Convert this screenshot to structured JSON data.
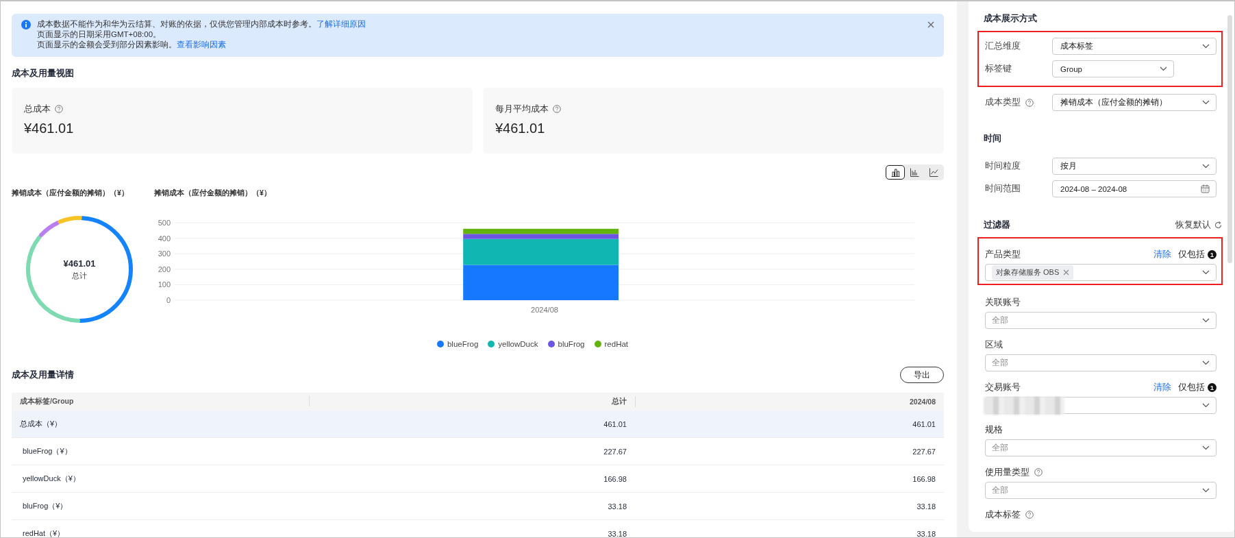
{
  "notice": {
    "lines": [
      {
        "text": "成本数据不能作为和华为云结算、对账的依据，仅供您管理内部成本时参考。",
        "link": "了解详细原因"
      },
      {
        "text": "页面显示的日期采用GMT+08:00。"
      },
      {
        "text": "页面显示的金额会受到部分因素影响。",
        "link": "查看影响因素"
      }
    ]
  },
  "overview": {
    "title": "成本及用量视图",
    "cards": [
      {
        "label": "总成本",
        "value": "¥461.01"
      },
      {
        "label": "每月平均成本",
        "value": "¥461.01"
      }
    ],
    "chart_types": [
      {
        "kind": "bar",
        "selected": true
      },
      {
        "kind": "histogram",
        "selected": false
      },
      {
        "kind": "line",
        "selected": false
      }
    ],
    "donut": {
      "title": "摊销成本（应付金额的摊销）（¥）",
      "total": "¥461.01",
      "total_label": "总计",
      "segments": [
        {
          "color": "#1484fc"
        },
        {
          "color": "#7ddab1"
        },
        {
          "color": "#b97ff0"
        },
        {
          "color": "#f8c325"
        }
      ]
    },
    "chart": {
      "chart_data": {
        "type": "bar",
        "title": "摊销成本（应付金额的摊销）（¥）",
        "categories": [
          "2024/08"
        ],
        "stacked": true,
        "grid": true,
        "legend": true,
        "ylim": [
          0,
          500
        ],
        "yticks": [
          0,
          100,
          200,
          300,
          400,
          500
        ],
        "series": [
          {
            "name": "blueFrog",
            "color": "#1677ff",
            "values": [
              228
            ]
          },
          {
            "name": "yellowDuck",
            "color": "#10b6b1",
            "values": [
              167
            ]
          },
          {
            "name": "bluFrog",
            "color": "#6d55e3",
            "values": [
              33
            ]
          },
          {
            "name": "redHat",
            "color": "#63b30f",
            "values": [
              33
            ]
          }
        ]
      }
    }
  },
  "details": {
    "title": "成本及用量详情",
    "export_label": "导出",
    "columns": [
      "成本标签/Group",
      "总计",
      "2024/08"
    ],
    "rows": [
      {
        "kind": "total",
        "cells": [
          "总成本（¥）",
          "461.01",
          "461.01"
        ]
      },
      {
        "kind": "item",
        "cells": [
          "blueFrog（¥）",
          "227.67",
          "227.67"
        ]
      },
      {
        "kind": "item",
        "cells": [
          "yellowDuck（¥）",
          "166.98",
          "166.98"
        ]
      },
      {
        "kind": "item",
        "cells": [
          "bluFrog（¥）",
          "33.18",
          "33.18"
        ]
      },
      {
        "kind": "item",
        "cells": [
          "redHat（¥）",
          "33.18",
          "33.18"
        ]
      }
    ]
  },
  "settings": {
    "sections": [
      {
        "title": "成本展示方式",
        "blocks": [
          {
            "highlighted": true,
            "fields": [
              {
                "kind": "select",
                "label": "汇总维度",
                "value": "成本标签"
              },
              {
                "kind": "short-select",
                "label": "标签键",
                "value": "Group"
              }
            ]
          },
          {
            "fields": [
              {
                "kind": "select",
                "label": "成本类型",
                "value": "摊销成本（应付金额的摊销）",
                "help": true
              }
            ]
          }
        ]
      },
      {
        "title": "时间",
        "blocks": [
          {
            "fields": [
              {
                "kind": "select",
                "label": "时间粒度",
                "value": "按月"
              },
              {
                "kind": "date",
                "label": "时间范围",
                "value": "2024-08 – 2024-08"
              }
            ]
          }
        ]
      },
      {
        "title": "过滤器",
        "reset_label": "恢复默认",
        "blocks": [
          {
            "highlighted": true,
            "fields": [
              {
                "kind": "filter",
                "label": "产品类型",
                "clear_label": "清除",
                "include_label": "仅包括",
                "count": "1",
                "tags": [
                  "对象存储服务 OBS"
                ]
              }
            ]
          },
          {
            "fields": [
              {
                "kind": "filter",
                "label": "关联账号",
                "placeholder": "全部"
              },
              {
                "kind": "filter",
                "label": "区域",
                "placeholder": "全部"
              },
              {
                "kind": "filter",
                "label": "交易账号",
                "clear_label": "清除",
                "include_label": "仅包括",
                "count": "1",
                "redacted": true
              },
              {
                "kind": "filter",
                "label": "规格",
                "placeholder": "全部"
              },
              {
                "kind": "filter",
                "label": "使用量类型",
                "help": true,
                "placeholder": "全部"
              },
              {
                "kind": "heading",
                "label": "成本标签",
                "help": true
              }
            ]
          }
        ]
      }
    ]
  }
}
